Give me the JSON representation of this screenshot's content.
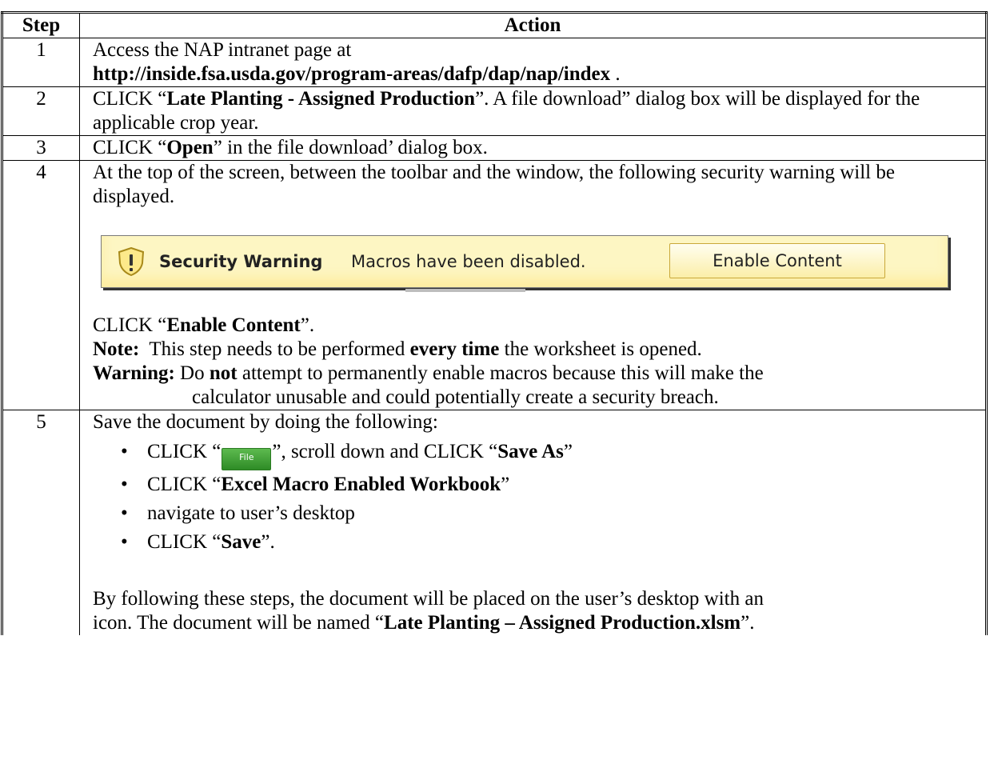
{
  "table": {
    "headers": {
      "step": "Step",
      "action": "Action"
    },
    "step1": {
      "num": "1",
      "line1": "Access the NAP intranet page at",
      "url": "http://inside.fsa.usda.gov/program-areas/dafp/dap/nap/index",
      "trail": " ."
    },
    "step2": {
      "num": "2",
      "pre": "CLICK “",
      "bold": "Late Planting - Assigned Production",
      "post": "”.  A file download” dialog box will be displayed for the applicable crop year."
    },
    "step3": {
      "num": "3",
      "pre": "CLICK “",
      "bold": "Open",
      "post": "” in the file download’ dialog box."
    },
    "step4": {
      "num": "4",
      "text": "At the top of the screen, between the toolbar and the window, the following security warning will be displayed.",
      "security_bar": {
        "title": "Security Warning",
        "message": "Macros have been disabled.",
        "button": "Enable Content",
        "icon": "shield-warning-icon"
      },
      "click_pre": "CLICK “",
      "click_bold": "Enable Content",
      "click_post": "”.",
      "note_label": "Note:",
      "note_pre": "  This step needs to be performed ",
      "note_bold": "every time",
      "note_post": " the worksheet is opened.",
      "warning_label": "Warning:",
      "warning_pre": " Do ",
      "warning_bold": "not",
      "warning_line1_post": " attempt to permanently enable macros because this will make the",
      "warning_line2": "calculator unusable and could potentially create a security breach."
    },
    "step5": {
      "num": "5",
      "intro": "Save the document by doing the following:",
      "b1_pre": "CLICK “",
      "b1_file_label": "File",
      "b1_mid": "”, scroll down and CLICK “",
      "b1_bold": "Save As",
      "b1_post": "”",
      "b2_pre": "CLICK “",
      "b2_bold": "Excel Macro Enabled Workbook",
      "b2_post": "”",
      "b3": "navigate to user’s desktop",
      "b4_pre": "CLICK “",
      "b4_bold": "Save",
      "b4_post": "”.",
      "closing_line1": "By following these steps, the document will be placed on the user’s desktop with an",
      "closing_line2_pre": "icon.  The document will be named “",
      "closing_bold": "Late Planting – Assigned Production.xlsm",
      "closing_post": "”."
    }
  }
}
